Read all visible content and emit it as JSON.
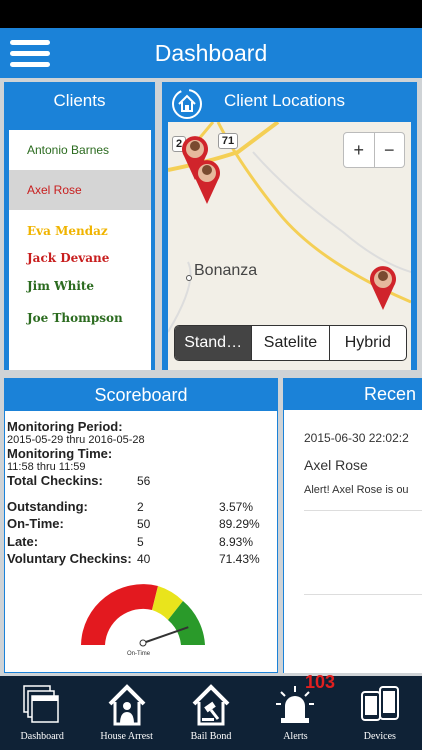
{
  "header": {
    "title": "Dashboard"
  },
  "clients": {
    "title": "Clients",
    "items": [
      {
        "name": "Antonio Barnes",
        "color": "#2b6b1f"
      },
      {
        "name": "Axel Rose",
        "color": "#c81e1e"
      },
      {
        "name": "Eva Mendaz",
        "color": "#f0b400"
      },
      {
        "name": "Jack Devane",
        "color": "#c81e1e"
      },
      {
        "name": "Jim White",
        "color": "#2b6b1f"
      },
      {
        "name": "Joe Thompson",
        "color": "#2b6b1f"
      }
    ]
  },
  "map": {
    "title": "Client Locations",
    "place_label": "Bonanza",
    "road_label_1": "71",
    "road_label_2": "2",
    "zoom_in": "+",
    "zoom_out": "−",
    "types": [
      "Stand…",
      "Satelite",
      "Hybrid"
    ],
    "selected_type": "Stand…"
  },
  "scoreboard": {
    "title": "Scoreboard",
    "monitoring_period_label": "Monitoring Period:",
    "monitoring_period_value": "2015-05-29 thru 2016-05-28",
    "monitoring_time_label": "Monitoring Time:",
    "monitoring_time_value": "11:58 thru 11:59",
    "total_label": "Total Checkins:",
    "total_value": "56",
    "rows": [
      {
        "label": "Outstanding:",
        "count": "2",
        "pct": "3.57%"
      },
      {
        "label": "On-Time:",
        "count": "50",
        "pct": "89.29%"
      },
      {
        "label": "Late:",
        "count": "5",
        "pct": "8.93%"
      },
      {
        "label": "Voluntary Checkins:",
        "count": "40",
        "pct": "71.43%"
      }
    ],
    "gauge_label": "On-Time",
    "gauge_value": 0.8929
  },
  "recent": {
    "title": "Recen",
    "timestamp": "2015-06-30 22:02:2",
    "name": "Axel Rose",
    "message": "Alert! Axel Rose is ou"
  },
  "tabs": [
    {
      "label": "Dashboard",
      "icon": "dashboard-icon"
    },
    {
      "label": "House Arrest",
      "icon": "house-arrest-icon"
    },
    {
      "label": "Bail Bond",
      "icon": "bail-bond-icon"
    },
    {
      "label": "Alerts",
      "icon": "alerts-icon"
    },
    {
      "label": "Devices",
      "icon": "devices-icon"
    }
  ],
  "alerts_badge": "103"
}
